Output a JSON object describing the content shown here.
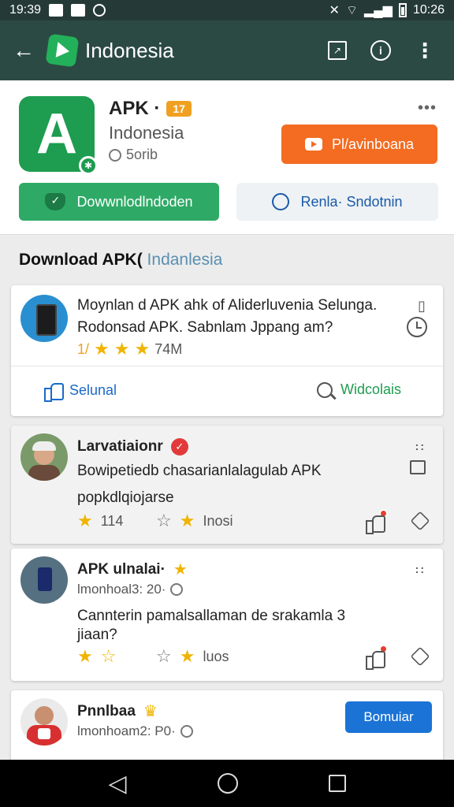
{
  "status_bar": {
    "time_left": "19:39",
    "time_right": "10:26"
  },
  "app_bar": {
    "title": "Indonesia"
  },
  "header": {
    "app_name": "APK ·",
    "tag": "17",
    "subtitle": "Indonesia",
    "meta": "5orib",
    "more": "•••",
    "play_button": "Pl/avinboana",
    "download_button": "Dowwnlodlndoden",
    "review_button": "Renla· Sndotnin"
  },
  "section": {
    "title": "Download APK(",
    "accent": " Indanlesia"
  },
  "cards": [
    {
      "line1": "Moynlan d APK ahk of Aliderluvenia Selunga.",
      "line2": "Rodonsad APK. Sabnlam Jppang am?",
      "rating_text": "74M",
      "rating_prefix": "1/",
      "like_label": "Selunal",
      "search_label": "Widcolais"
    },
    {
      "name": "Larvatiaionr",
      "line1": "Bowipetiedb chasarianlalagulab APK",
      "line2": "popkdlqiojarse",
      "count": "114",
      "rating_label": "Inosi"
    },
    {
      "name": "APK ulnalai·",
      "meta": "lmonhoal3: 20·",
      "line1": "Cannterin pamalsallaman de srakamla 3",
      "line2": "jiaan?",
      "rating_label": "luos"
    },
    {
      "name": "Pnnlbaa",
      "meta": "lmonhoam2: P0·",
      "subscribe": "Bomuiar"
    }
  ],
  "icons": {
    "back": "arrow-left-icon",
    "appbar_actions": [
      "square-icon",
      "info-icon",
      "more-vert-icon"
    ]
  },
  "colors": {
    "app_bar": "#2c4a44",
    "play_button": "#f36c21",
    "download_button": "#2eaa66",
    "subscribe_button": "#1b73d6",
    "star": "#f0b400"
  }
}
